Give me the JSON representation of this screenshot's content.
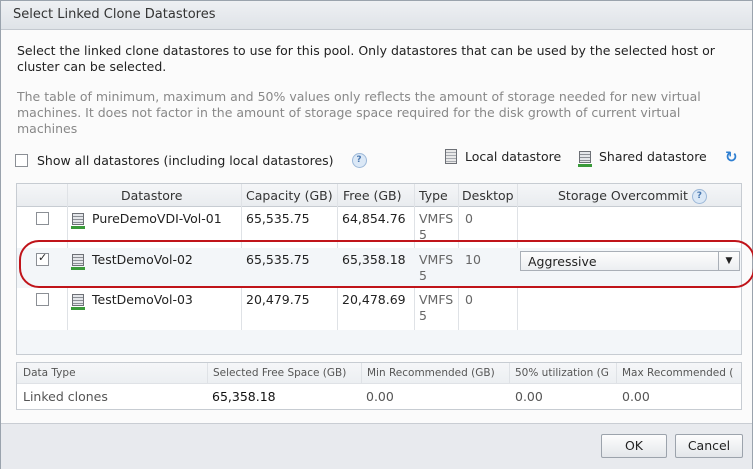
{
  "title": "Select Linked Clone Datastores",
  "intro": "Select the linked clone datastores to use for this pool. Only datastores that can be used by the selected host or cluster can be selected.",
  "note": "The table of minimum, maximum and 50% values only reflects the amount of storage needed for new virtual machines. It does not factor in the amount of storage space required for the disk growth of current virtual machines",
  "show_all_label": "Show all datastores (including local datastores)",
  "legend": {
    "local": "Local datastore",
    "shared": "Shared datastore"
  },
  "columns": [
    "Datastore",
    "Capacity (GB)",
    "Free (GB)",
    "Type",
    "Desktop",
    "Storage Overcommit"
  ],
  "rows": [
    {
      "name": "PureDemoVDI-Vol-01",
      "capacity": "65,535.75",
      "free": "64,854.76",
      "type1": "VMFS",
      "type2": "5",
      "desktop": "0",
      "overcommit": "",
      "checked": false
    },
    {
      "name": "TestDemoVol-02",
      "capacity": "65,535.75",
      "free": "65,358.18",
      "type1": "VMFS",
      "type2": "5",
      "desktop": "10",
      "overcommit": "Aggressive",
      "checked": true
    },
    {
      "name": "TestDemoVol-03",
      "capacity": "20,479.75",
      "free": "20,478.69",
      "type1": "VMFS",
      "type2": "5",
      "desktop": "0",
      "overcommit": "",
      "checked": false
    }
  ],
  "summary": {
    "headers": [
      "Data Type",
      "Selected Free Space (GB)",
      "Min Recommended (GB)",
      "50% utilization (G",
      "Max Recommended ("
    ],
    "values": [
      "Linked clones",
      "65,358.18",
      "0.00",
      "0.00",
      "0.00"
    ]
  },
  "buttons": {
    "ok": "OK",
    "cancel": "Cancel"
  },
  "colors": {
    "highlight": "#c0141a",
    "accent": "#2f7fd1"
  }
}
